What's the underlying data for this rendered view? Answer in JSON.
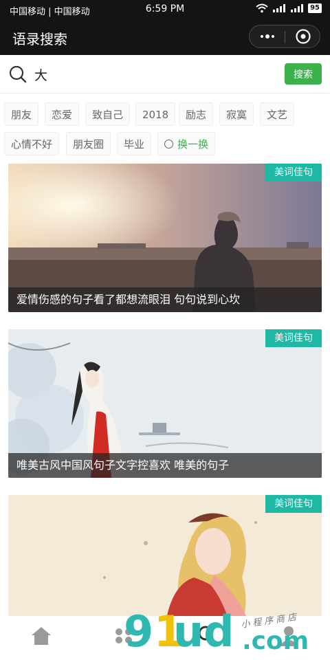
{
  "status_bar": {
    "carriers": "中国移动 | 中国移动",
    "time": "6:59 PM",
    "battery": "95"
  },
  "title_bar": {
    "title": "语录搜索"
  },
  "search": {
    "value": "大",
    "button_label": "搜索"
  },
  "tags": {
    "items": [
      "朋友",
      "恋爱",
      "致自己",
      "2018",
      "励志",
      "寂寞",
      "文艺",
      "心情不好",
      "朋友圈",
      "毕业"
    ],
    "refresh_label": "换一换"
  },
  "cards": [
    {
      "badge": "美词佳句",
      "caption": "爱情伤感的句子看了都想流眼泪 句句说到心坎"
    },
    {
      "badge": "美词佳句",
      "caption": "唯美古风中国风句子文字控喜欢 唯美的句子"
    },
    {
      "badge": "美词佳句",
      "caption": ""
    }
  ],
  "watermark": {
    "nine": "9",
    "one": "1",
    "ud": "ud",
    "com": ".com",
    "shop": "小程序商店"
  },
  "colors": {
    "accent_green": "#3cb04a",
    "badge_teal": "#1fb8a5",
    "title_bar_bg": "#141414"
  }
}
